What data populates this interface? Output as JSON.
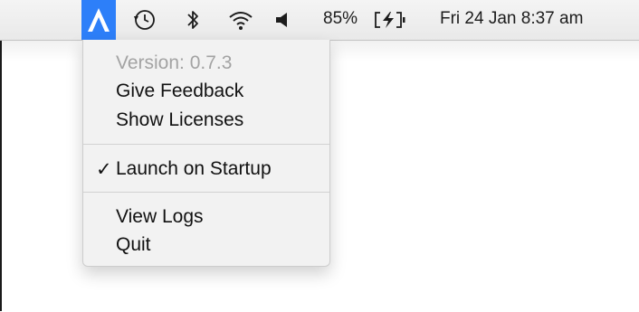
{
  "menubar": {
    "app_icon": "letter-a-app-icon",
    "time_machine_icon": "time-machine-icon",
    "bluetooth_icon": "bluetooth-icon",
    "wifi_icon": "wifi-icon",
    "volume_icon": "volume-icon",
    "battery_percent": "85%",
    "battery_icon": "battery-charging-icon",
    "clock": "Fri 24 Jan  8:37 am",
    "app_icon_color": "#2d7ff9"
  },
  "menu": {
    "version": "Version: 0.7.3",
    "give_feedback": "Give Feedback",
    "show_licenses": "Show Licenses",
    "launch_on_startup": "Launch on Startup",
    "launch_on_startup_checked": true,
    "check_mark": "✓",
    "view_logs": "View Logs",
    "quit": "Quit"
  }
}
